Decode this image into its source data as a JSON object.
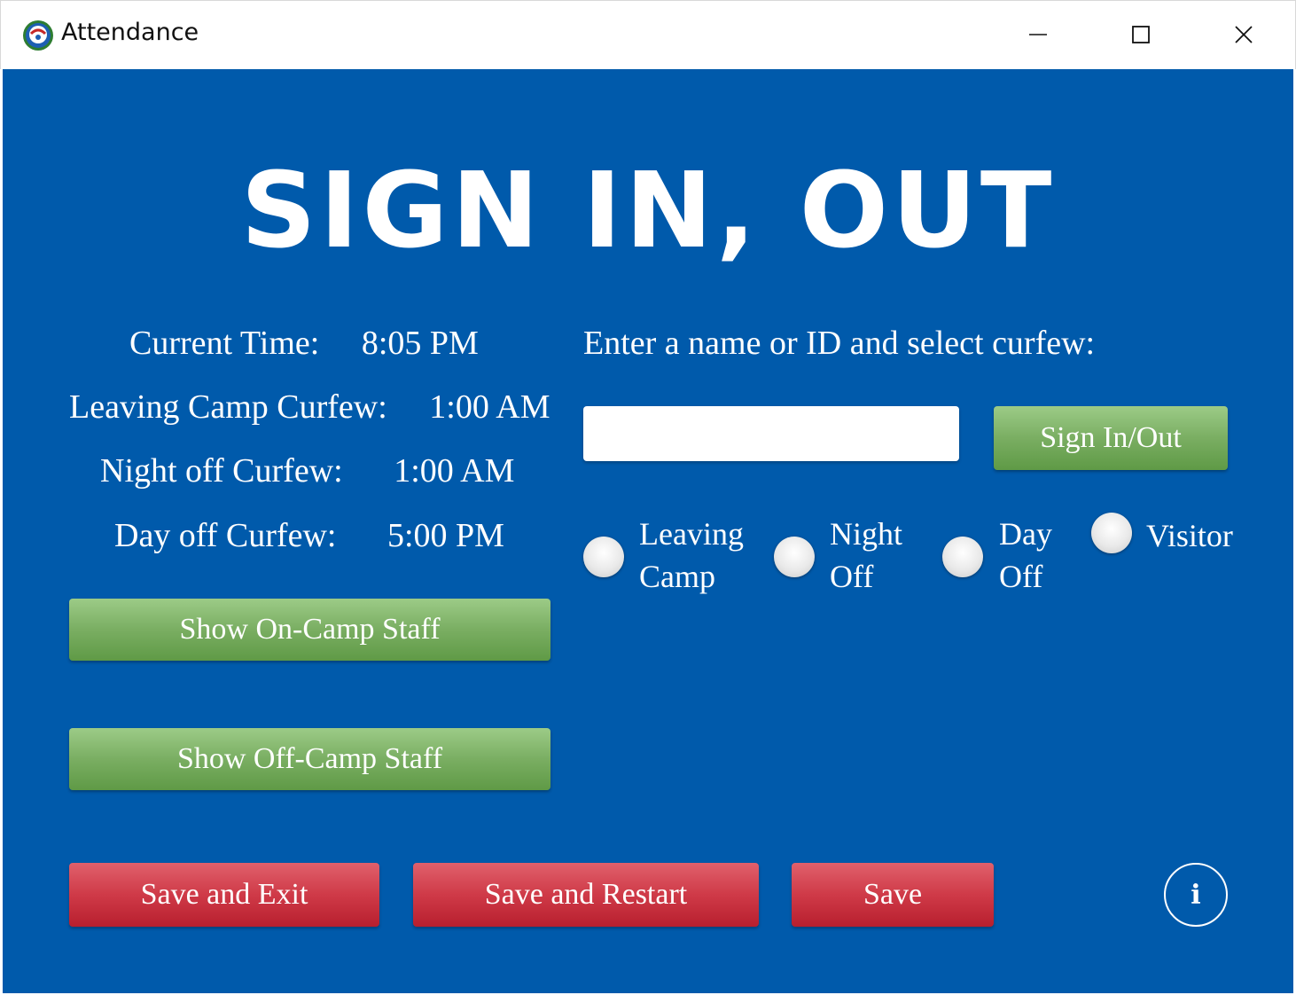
{
  "window": {
    "title": "Attendance",
    "icon": "app-globe-icon",
    "controls": [
      "minimize-icon",
      "maximize-icon",
      "close-icon"
    ]
  },
  "main": {
    "headline": "SIGN IN, OUT",
    "info": {
      "current_time_label": "Current Time:",
      "current_time_value": "8:05 PM",
      "leaving_camp_label": "Leaving Camp Curfew:",
      "leaving_camp_value": "1:00 AM",
      "night_off_label": "Night off Curfew:",
      "night_off_value": "1:00 AM",
      "day_off_label": "Day off Curfew:",
      "day_off_value": "5:00 PM"
    },
    "show_on_camp_label": "Show On-Camp Staff",
    "show_off_camp_label": "Show Off-Camp Staff",
    "prompt": "Enter a name or ID and select curfew:",
    "name_input": {
      "value": "",
      "placeholder": ""
    },
    "sign_button_label": "Sign In/Out",
    "curfew_options": [
      {
        "line1": "Leaving",
        "line2": "Camp"
      },
      {
        "line1": "Night",
        "line2": "Off"
      },
      {
        "line1": "Day",
        "line2": "Off"
      },
      {
        "line1": "Visitor",
        "line2": ""
      }
    ]
  },
  "footer": {
    "save_exit_label": "Save and Exit",
    "save_restart_label": "Save and Restart",
    "save_label": "Save",
    "info_label": "i"
  },
  "colors": {
    "background": "#005aab",
    "green_button": "#7aae62",
    "red_button": "#cf3a48",
    "text": "#ffffff"
  }
}
